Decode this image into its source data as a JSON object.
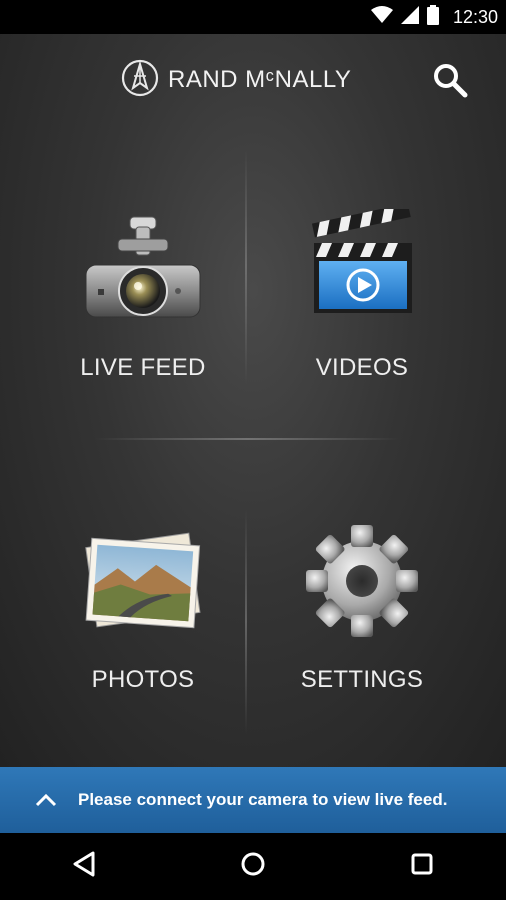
{
  "status_bar": {
    "time": "12:30",
    "icons": [
      "wifi-icon",
      "signal-icon",
      "battery-icon"
    ]
  },
  "header": {
    "logo_text": "RAND MᶜNALLY",
    "logo_icon": "compass-rose-icon",
    "search_icon": "search-icon"
  },
  "tiles": [
    {
      "label": "LIVE FEED",
      "icon": "dashcam-icon"
    },
    {
      "label": "VIDEOS",
      "icon": "clapperboard-icon"
    },
    {
      "label": "PHOTOS",
      "icon": "photos-icon"
    },
    {
      "label": "SETTINGS",
      "icon": "gear-icon"
    }
  ],
  "banner": {
    "text": "Please connect your camera to view live feed.",
    "icon": "chevron-up-icon"
  },
  "nav": {
    "icons": [
      "back-icon",
      "home-icon",
      "recents-icon"
    ]
  },
  "colors": {
    "banner": "#2a6fae",
    "background": "#333333",
    "text": "#eeeeee"
  }
}
